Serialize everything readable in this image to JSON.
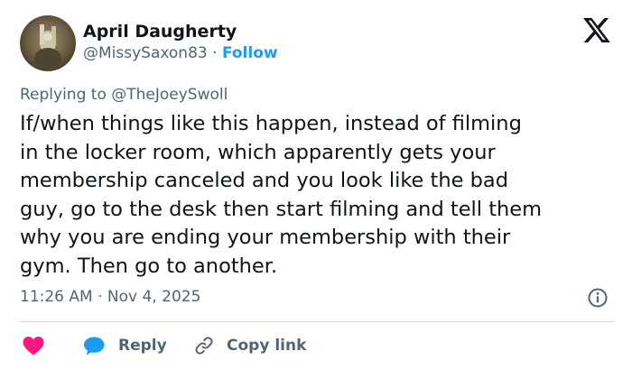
{
  "colors": {
    "accent": "#1d9bf0",
    "like": "#f91880",
    "muted": "#536471",
    "text": "#0f1419",
    "divider": "#cfd9de"
  },
  "author": {
    "name": "April Daugherty",
    "handle": "@MissySaxon83",
    "separator": "·",
    "follow_label": "Follow",
    "avatar_icon": "user-avatar-photo"
  },
  "brand": {
    "logo_icon": "x-logo-icon"
  },
  "tweet": {
    "replying_prefix": "Replying to ",
    "replying_to": "@TheJoeySwoll",
    "text": "If/when things like this happen, instead of filming\nin the locker room, which apparently gets your\nmembership canceled and you look like the bad\nguy, go to the desk then start filming and tell them\nwhy you are ending your membership with their\ngym. Then go to another.",
    "time": "11:26 AM",
    "date_separator": "·",
    "date": "Nov 4, 2025"
  },
  "actions": {
    "like_icon": "heart-icon",
    "reply_label": "Reply",
    "reply_icon": "speech-bubble-icon",
    "copy_label": "Copy link",
    "copy_icon": "link-icon",
    "info_icon": "info-icon"
  }
}
